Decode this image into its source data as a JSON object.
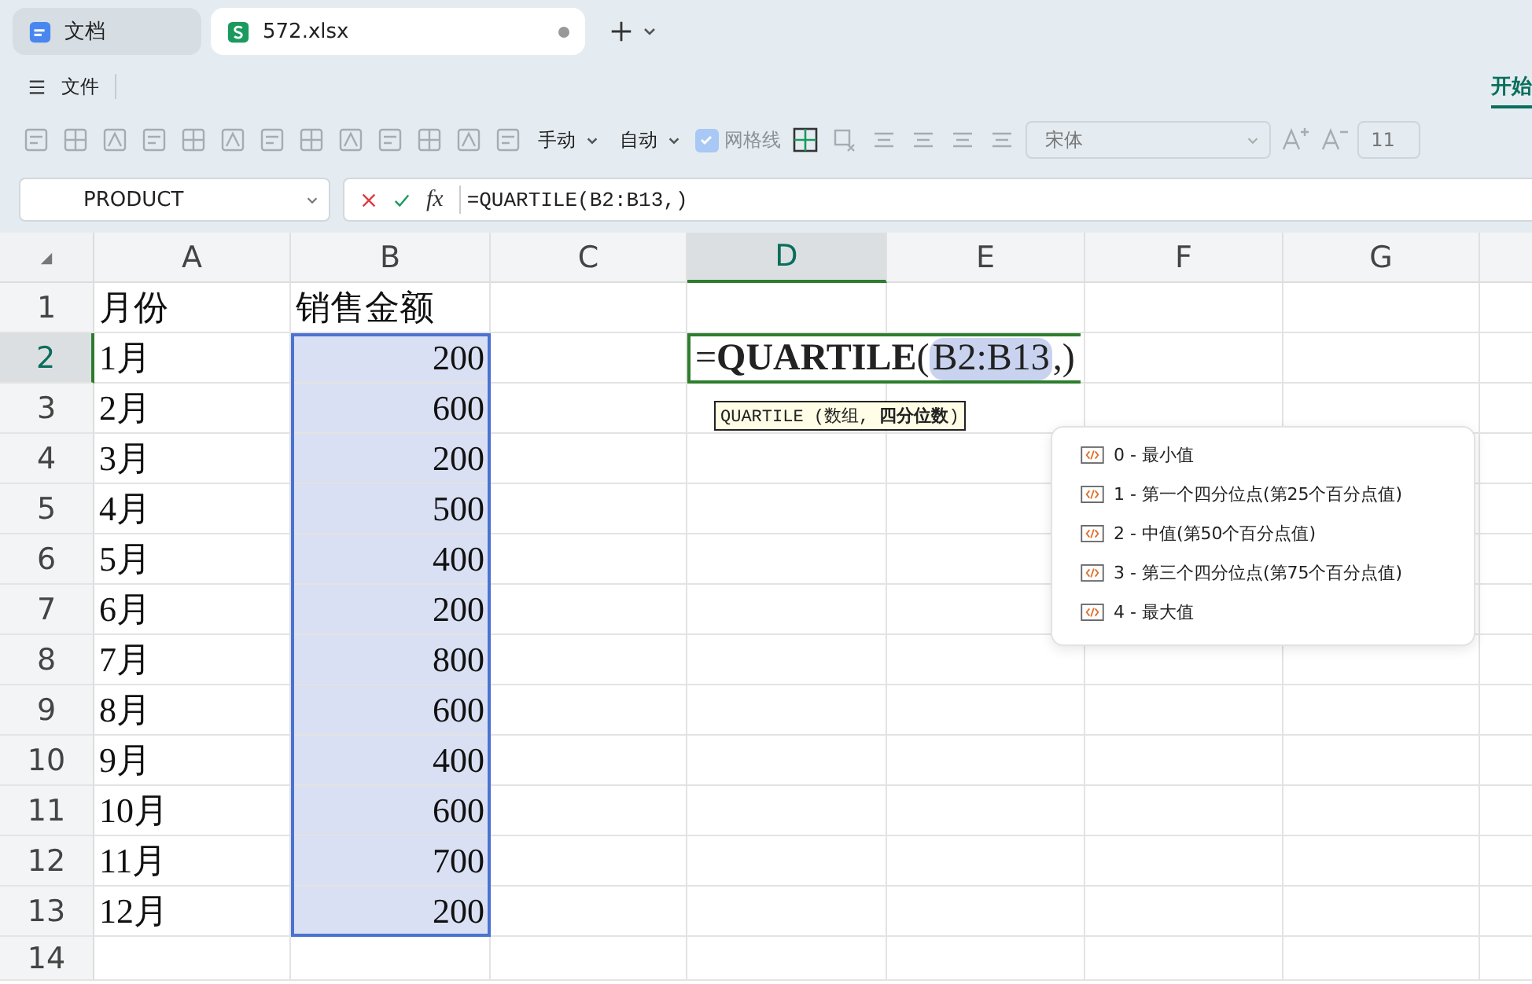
{
  "tabs": [
    {
      "label": "文档",
      "kind": "doc",
      "selected": false,
      "modified": false
    },
    {
      "label": "572.xlsx",
      "kind": "sheet",
      "selected": true,
      "modified": true
    }
  ],
  "menu": {
    "label": "文件"
  },
  "ribbon_tab": {
    "label": "开始",
    "selected": true
  },
  "toolbar": {
    "row_height_mode": "手动",
    "col_width_mode": "自动",
    "gridlines": {
      "label": "网格线",
      "checked": true
    },
    "font": "宋体",
    "font_size": "11"
  },
  "name_box": "PRODUCT",
  "function_button": "fx",
  "formula": "=QUARTILE(B2:B13,)",
  "columns": [
    {
      "label": "A",
      "selected": false
    },
    {
      "label": "B",
      "selected": false
    },
    {
      "label": "C",
      "selected": false
    },
    {
      "label": "D",
      "selected": true
    },
    {
      "label": "E",
      "selected": false
    },
    {
      "label": "F",
      "selected": false
    },
    {
      "label": "G",
      "selected": false
    }
  ],
  "rows": [
    {
      "header": "1",
      "selected": false,
      "in_range": false,
      "a": "月份",
      "b": "销售金额"
    },
    {
      "header": "2",
      "selected": true,
      "in_range": true,
      "a": "1月",
      "b": "200"
    },
    {
      "header": "3",
      "selected": false,
      "in_range": true,
      "a": "2月",
      "b": "600"
    },
    {
      "header": "4",
      "selected": false,
      "in_range": true,
      "a": "3月",
      "b": "200"
    },
    {
      "header": "5",
      "selected": false,
      "in_range": true,
      "a": "4月",
      "b": "500"
    },
    {
      "header": "6",
      "selected": false,
      "in_range": true,
      "a": "5月",
      "b": "400"
    },
    {
      "header": "7",
      "selected": false,
      "in_range": true,
      "a": "6月",
      "b": "200"
    },
    {
      "header": "8",
      "selected": false,
      "in_range": true,
      "a": "7月",
      "b": "800"
    },
    {
      "header": "9",
      "selected": false,
      "in_range": true,
      "a": "8月",
      "b": "600"
    },
    {
      "header": "10",
      "selected": false,
      "in_range": true,
      "a": "9月",
      "b": "400"
    },
    {
      "header": "11",
      "selected": false,
      "in_range": true,
      "a": "10月",
      "b": "600"
    },
    {
      "header": "12",
      "selected": false,
      "in_range": true,
      "a": "11月",
      "b": "700"
    },
    {
      "header": "13",
      "selected": false,
      "in_range": true,
      "a": "12月",
      "b": "200"
    },
    {
      "header": "14",
      "selected": false,
      "in_range": false
    }
  ],
  "cell_editor": [
    {
      "text": "=",
      "kind": "plain"
    },
    {
      "text": "QUARTILE",
      "kind": "bold"
    },
    {
      "text": "(",
      "kind": "plain"
    },
    {
      "text": "B2:B13",
      "kind": "ref"
    },
    {
      "text": ",)",
      "kind": "plain"
    }
  ],
  "syntax_tip": "QUARTILE (数组, **四分位数**)",
  "suggestions": [
    "0 - 最小值",
    "1 - 第一个四分位点(第25个百分点值)",
    "2 - 中值(第50个百分点值)",
    "3 - 第三个四分位点(第75个百分点值)",
    "4 - 最大值"
  ]
}
